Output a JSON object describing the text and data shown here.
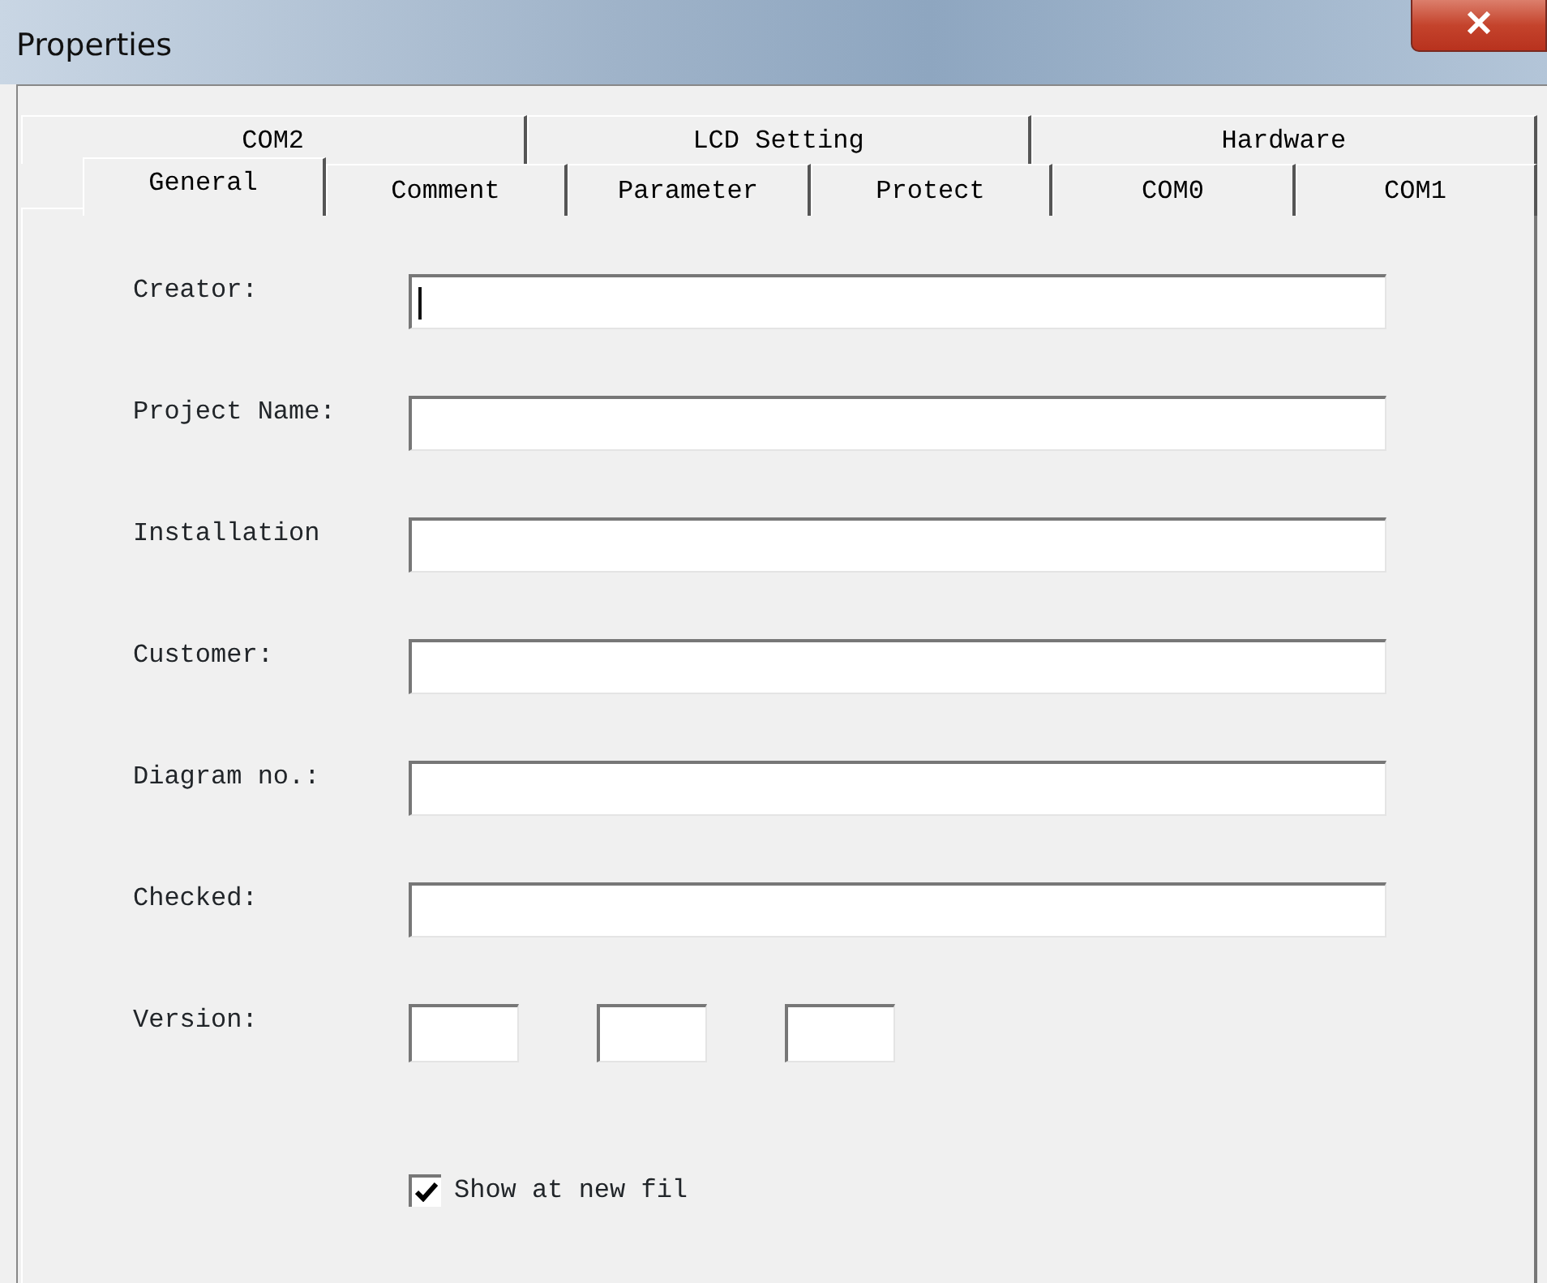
{
  "window": {
    "title": "Properties"
  },
  "tab_rows": [
    [
      {
        "label": "COM2",
        "selected": false
      },
      {
        "label": "LCD Setting",
        "selected": false
      },
      {
        "label": "Hardware",
        "selected": false
      }
    ],
    [
      {
        "label": "General",
        "selected": true
      },
      {
        "label": "Comment",
        "selected": false
      },
      {
        "label": "Parameter",
        "selected": false
      },
      {
        "label": "Protect",
        "selected": false
      },
      {
        "label": "COM0",
        "selected": false
      },
      {
        "label": "COM1",
        "selected": false
      }
    ]
  ],
  "fields": [
    {
      "label": "Creator:",
      "focused": true
    },
    {
      "label": "Project Name:",
      "focused": false
    },
    {
      "label": "Installation",
      "focused": false
    },
    {
      "label": "Customer:",
      "focused": false
    },
    {
      "label": "Diagram no.:",
      "focused": false
    },
    {
      "label": "Checked:",
      "focused": false
    }
  ],
  "version": {
    "label": "Version:"
  },
  "show_at_new_file": {
    "label": "Show at new fil",
    "checked": true
  }
}
